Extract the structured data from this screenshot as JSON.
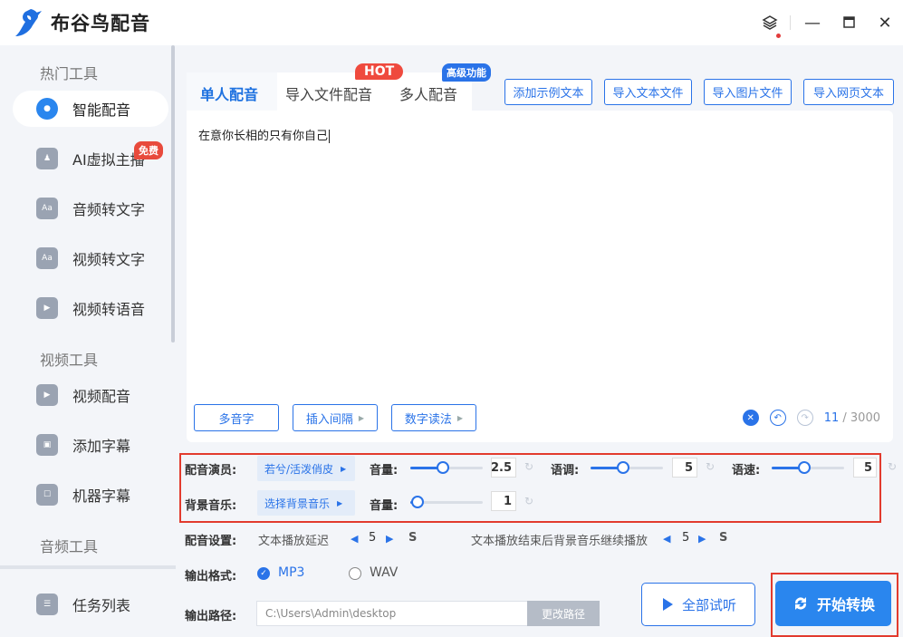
{
  "app": {
    "title": "布谷鸟配音",
    "logo_icon": "bird-logo-icon"
  },
  "window": {
    "layers_icon": "layers-icon",
    "minimize": "—",
    "maximize": "▭",
    "close": "✕"
  },
  "sidebar": {
    "section_hot": "热门工具",
    "section_video": "视频工具",
    "section_audio": "音频工具",
    "free_badge": "免费",
    "items": [
      {
        "label": "智能配音",
        "icon": "voice-icon"
      },
      {
        "label": "AI虚拟主播",
        "icon": "avatar-icon"
      },
      {
        "label": "音频转文字",
        "icon": "audio-text-icon"
      },
      {
        "label": "视频转文字",
        "icon": "video-text-icon"
      },
      {
        "label": "视频转语音",
        "icon": "video-voice-icon"
      },
      {
        "label": "视频配音",
        "icon": "video-dub-icon"
      },
      {
        "label": "添加字幕",
        "icon": "subtitle-icon"
      },
      {
        "label": "机器字幕",
        "icon": "robot-subtitle-icon"
      },
      {
        "label": "任务列表",
        "icon": "task-list-icon"
      }
    ]
  },
  "tabs": {
    "single": "单人配音",
    "import_file": "导入文件配音",
    "multi": "多人配音",
    "hot": "HOT",
    "advanced": "高级功能"
  },
  "toolbar": {
    "add_sample": "添加示例文本",
    "import_text": "导入文本文件",
    "import_image": "导入图片文件",
    "import_web": "导入网页文本"
  },
  "editor": {
    "text": "在意你长相的只有你自己",
    "polyphone": "多音字",
    "insert_pause": "插入间隔",
    "number_read": "数字读法",
    "count": "11",
    "max": "/ 3000"
  },
  "settings": {
    "voice_label": "配音演员:",
    "voice_value": "若兮/活泼俏皮",
    "volume_label": "音量:",
    "volume_value": "2.5",
    "tone_label": "语调:",
    "tone_value": "5",
    "speed_label": "语速:",
    "speed_value": "5",
    "bgm_label": "背景音乐:",
    "bgm_value": "选择背景音乐",
    "bgm_volume_label": "音量:",
    "bgm_volume_value": "1",
    "volume_fraction": 0.45,
    "tone_fraction": 0.45,
    "speed_fraction": 0.45,
    "bgm_volume_fraction": 0.1
  },
  "dubbing": {
    "label": "配音设置:",
    "delay_text": "文本播放延迟",
    "delay_value": "5",
    "unit": "S",
    "after_text": "文本播放结束后背景音乐继续播放",
    "after_value": "5"
  },
  "output": {
    "format_label": "输出格式:",
    "mp3": "MP3",
    "wav": "WAV",
    "path_label": "输出路径:",
    "path_value": "C:\\Users\\Admin\\desktop",
    "change_path": "更改路径"
  },
  "actions": {
    "listen_all": "全部试听",
    "start": "开始转换"
  }
}
